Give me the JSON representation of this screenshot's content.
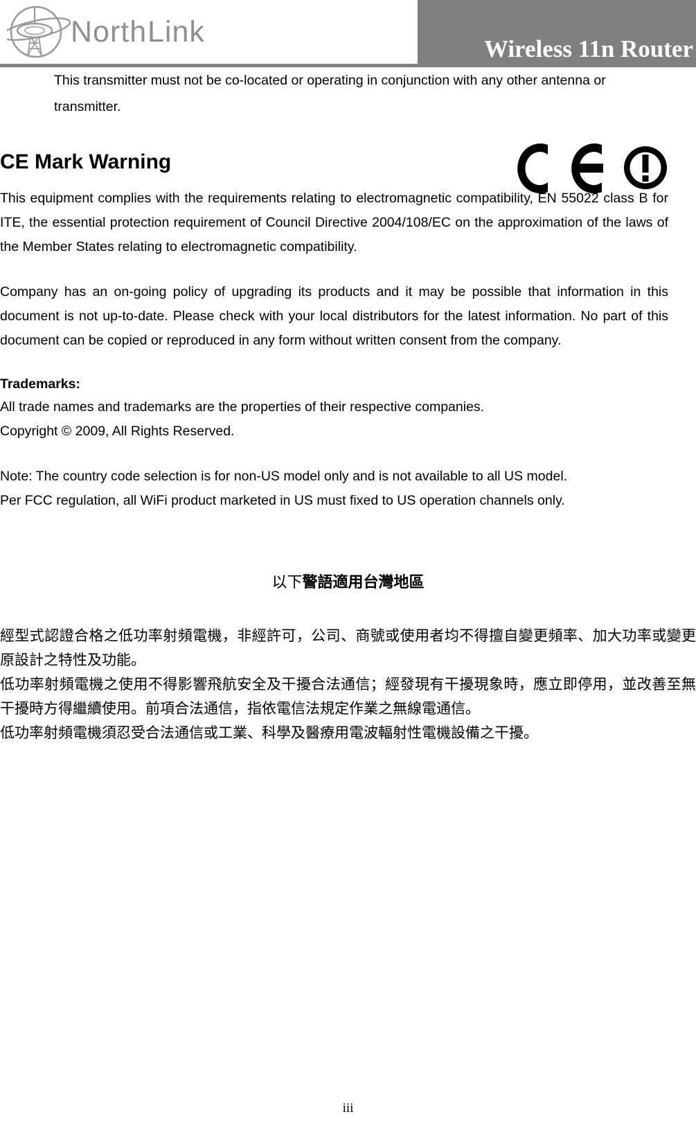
{
  "header": {
    "logo_text": "North Link",
    "logo_icon": "globe-satellite-dish-logo",
    "banner_title": "Wireless 11n Router",
    "banner_color": "#808080"
  },
  "marks": {
    "ce_mark": "CE",
    "alert_mark": "exclamation-in-circle"
  },
  "content": {
    "intro_paragraph": "This transmitter must not be co-located or operating in conjunction with any other antenna or transmitter.",
    "ce_heading": "CE Mark Warning",
    "ce_paragraph": "This equipment complies with the requirements relating to electromagnetic compatibility, EN 55022 class B for ITE, the essential protection requirement of Council Directive 2004/108/EC on the approximation of the laws of the Member States relating to electromagnetic compatibility.",
    "company_paragraph": "Company has an on-going policy of upgrading its products and it may be possible that information in this document is not up-to-date. Please check with your local distributors for the latest information. No part of this document can be copied or reproduced in any form without written consent from the company.",
    "trademarks_label": "Trademarks:",
    "trademarks_line": "All trade names and trademarks are the properties of their respective companies.",
    "copyright_line": "Copyright © 2009, All Rights Reserved.",
    "note_line_1": "Note: The country code selection is for non-US model only and is not available to all US model.",
    "note_line_2": "Per FCC regulation, all WiFi product marketed in US must fixed to US operation channels only.",
    "taiwan_heading_light": "以下",
    "taiwan_heading_bold": "警語適用台灣地區",
    "taiwan_paragraph_1": "經型式認證合格之低功率射頻電機，非經許可，公司、商號或使用者均不得擅自變更頻率、加大功率或變更原設計之特性及功能。",
    "taiwan_paragraph_2": "低功率射頻電機之使用不得影響飛航安全及干擾合法通信；經發現有干擾現象時，應立即停用，並改善至無干擾時方得繼續使用。前項合法通信，指依電信法規定作業之無線電通信。",
    "taiwan_paragraph_3": "低功率射頻電機須忍受合法通信或工業、科學及醫療用電波輻射性電機設備之干擾。"
  },
  "footer": {
    "page_number": "iii"
  }
}
